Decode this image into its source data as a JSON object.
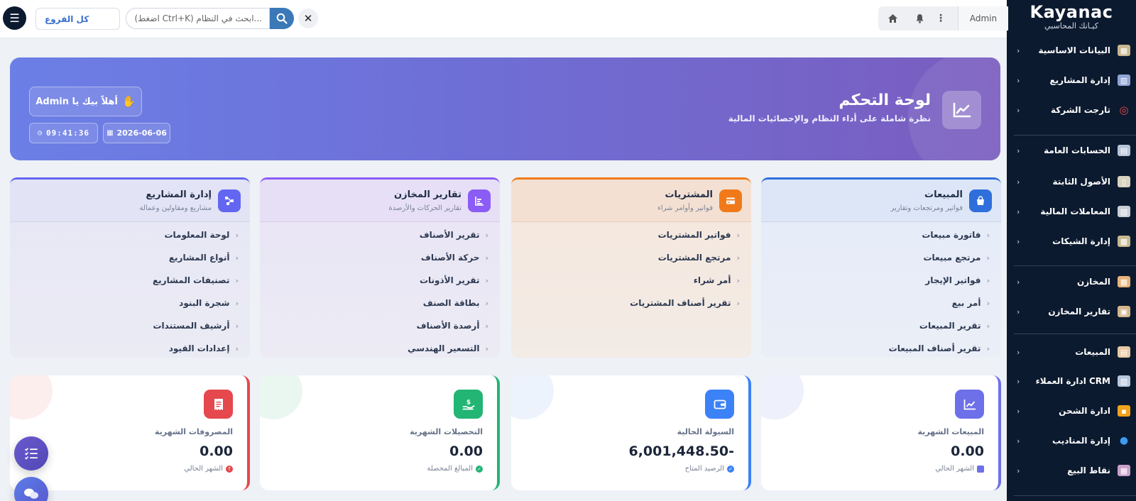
{
  "sidebar": {
    "brand_en": "Kayanac",
    "brand_ar": "كيـانك المحاسبي",
    "items": [
      {
        "label": "البيانات الاساسية",
        "icon": "database-icon"
      },
      {
        "label": "إدارة المشاريع",
        "icon": "buildings-icon"
      },
      {
        "label": "تارجت الشركة",
        "icon": "target-icon"
      },
      {
        "label": "الحسابات العامة",
        "icon": "accounts-icon"
      },
      {
        "label": "الأصول الثابتة",
        "icon": "assets-icon"
      },
      {
        "label": "المعاملات المالية",
        "icon": "finance-icon"
      },
      {
        "label": "إدارة الشيكات",
        "icon": "cheque-icon"
      },
      {
        "label": "المخازن",
        "icon": "warehouse-icon"
      },
      {
        "label": "تقارير المخازن",
        "icon": "inventory-report-icon"
      },
      {
        "label": "المبيعات",
        "icon": "sales-icon"
      },
      {
        "label": "CRM ادارة العملاء",
        "icon": "crm-icon"
      },
      {
        "label": "ادارة الشحن",
        "icon": "shipping-icon"
      },
      {
        "label": "إدارة المناديب",
        "icon": "agents-icon"
      },
      {
        "label": "نقاط البيع",
        "icon": "pos-icon"
      }
    ]
  },
  "topbar": {
    "branch": "كل الفروع",
    "search_placeholder": "...ابحث في النظام (Ctrl+K اضغط)",
    "user": "Admin"
  },
  "hero": {
    "title": "لوحة التحكم",
    "subtitle": "نظرة شاملة على أداء النظام والإحصائيات المالية",
    "welcome": "أهلاً بيك يا Admin",
    "date": "2026-06-06",
    "time": "09:41:36"
  },
  "modules": [
    {
      "title": "المبيعات",
      "subtitle": "فواتير ومرتجعات وتقارير",
      "color": "#2f6fdc",
      "items": [
        "فاتورة مبيعات",
        "مرتجع مبيعات",
        "فواتير الإيجار",
        "أمر بيع",
        "تقرير المبيعات",
        "تقرير أصناف المبيعات"
      ]
    },
    {
      "title": "المشتريات",
      "subtitle": "فواتير وأوامر شراء",
      "color": "#f07a1a",
      "items": [
        "فواتير المشتريات",
        "مرتجع المشتريات",
        "أمر شراء",
        "تقرير أصناف المشتريات"
      ]
    },
    {
      "title": "تقارير المخازن",
      "subtitle": "تقارير الحركات والأرصدة",
      "color": "#8b5cf6",
      "items": [
        "تقرير الأصناف",
        "حركة الأصناف",
        "تقرير الأذونات",
        "بطاقة الصنف",
        "أرصدة الأصناف",
        "التسعير الهندسي"
      ]
    },
    {
      "title": "إدارة المشاريع",
      "subtitle": "مشاريع ومقاولين وعمالة",
      "color": "#6366f1",
      "items": [
        "لوحة المعلومات",
        "أنواع المشاريع",
        "تصنيفات المشاريع",
        "شجرة البنود",
        "أرشيف المستندات",
        "إعدادات القيود"
      ]
    }
  ],
  "stats": [
    {
      "label": "المبيعات الشهرية",
      "value": "0.00",
      "note": "الشهر الحالي",
      "color": "#6d70e8",
      "icon": "chart-line-icon"
    },
    {
      "label": "السيولة الحالية",
      "value": "6,001,448.50-",
      "note": "الرصيد المتاح",
      "color": "#3b82f6",
      "icon": "wallet-icon"
    },
    {
      "label": "التحصيلات الشهرية",
      "value": "0.00",
      "note": "المبالغ المحصلة",
      "color": "#22b573",
      "icon": "hand-money-icon"
    },
    {
      "label": "المصروفات الشهرية",
      "value": "0.00",
      "note": "الشهر الحالي",
      "color": "#e5484d",
      "icon": "receipt-icon"
    }
  ]
}
